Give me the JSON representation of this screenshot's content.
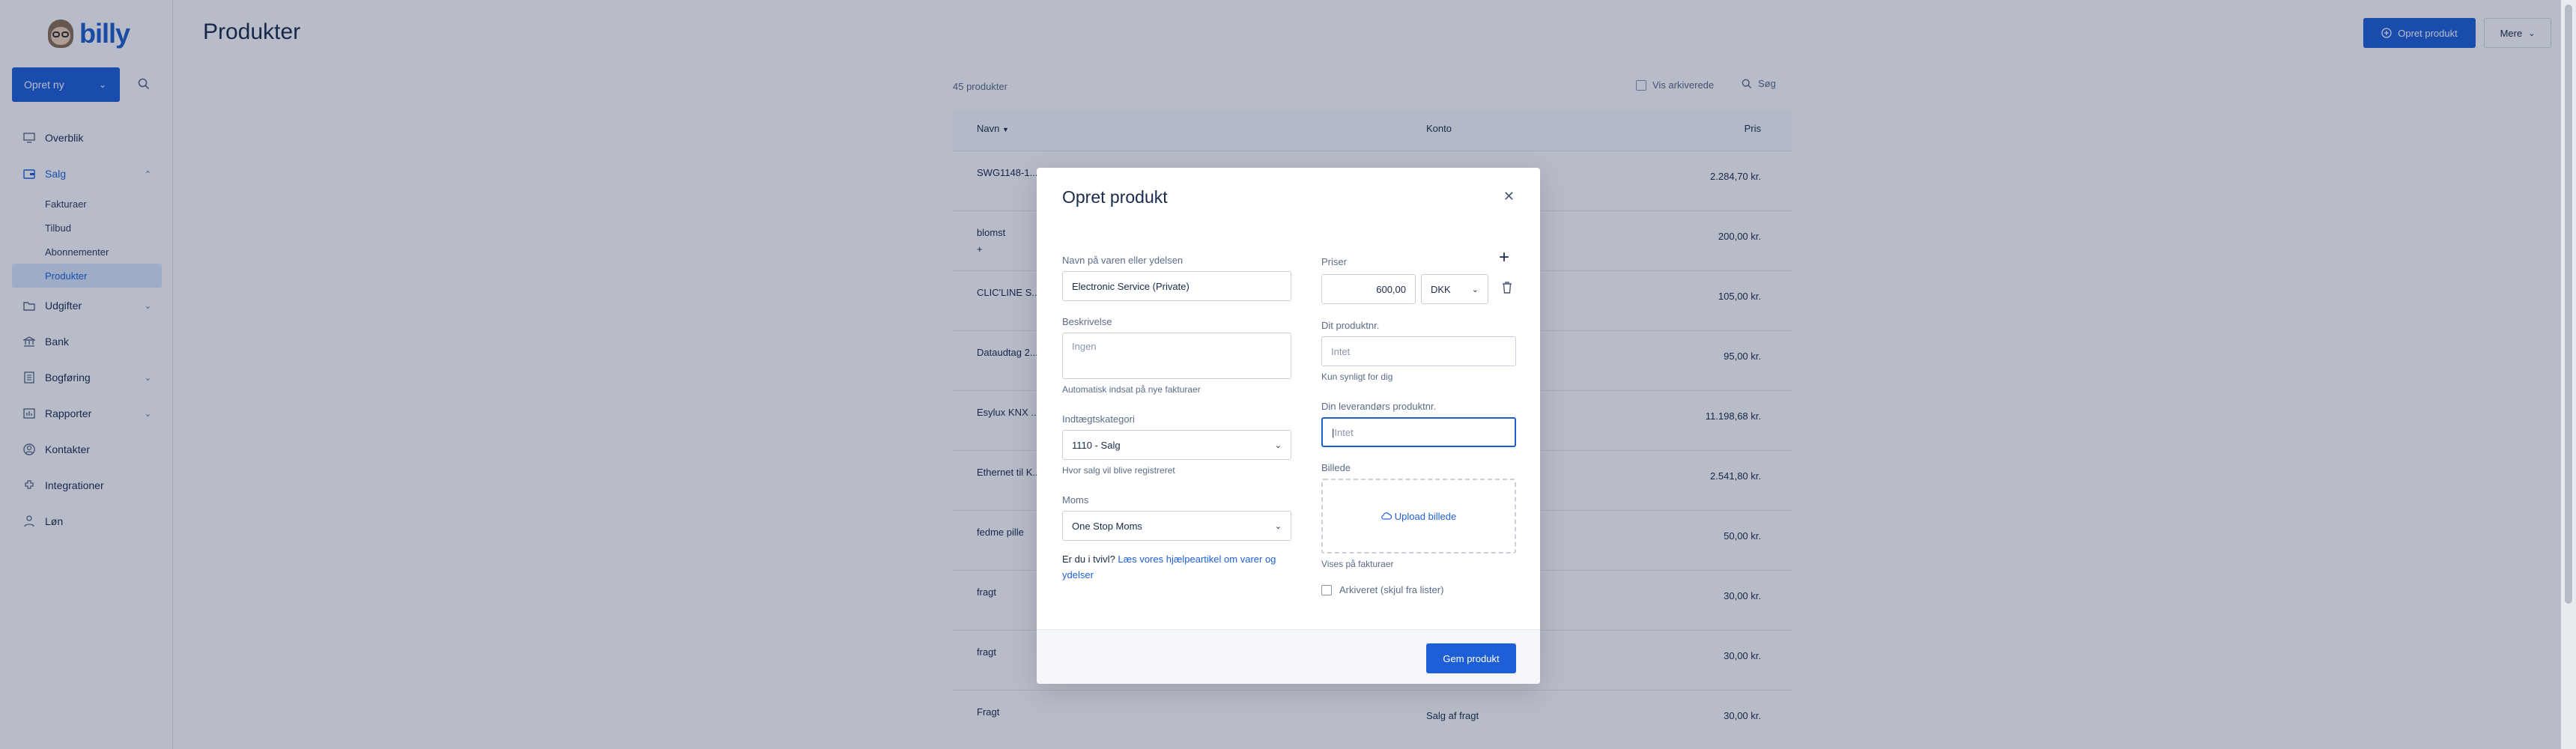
{
  "app": {
    "logo_text": "billy"
  },
  "sidebar": {
    "new_button": "Opret ny",
    "items": [
      {
        "label": "Overblik",
        "icon": "monitor-icon"
      },
      {
        "label": "Salg",
        "icon": "wallet-icon"
      },
      {
        "label": "Udgifter",
        "icon": "folder-icon"
      },
      {
        "label": "Bank",
        "icon": "bank-icon"
      },
      {
        "label": "Bogføring",
        "icon": "ledger-icon"
      },
      {
        "label": "Rapporter",
        "icon": "report-icon"
      },
      {
        "label": "Kontakter",
        "icon": "contact-icon"
      },
      {
        "label": "Integrationer",
        "icon": "integration-icon"
      },
      {
        "label": "Løn",
        "icon": "salary-icon"
      }
    ],
    "salg_sub": [
      "Fakturaer",
      "Tilbud",
      "Abonnementer",
      "Produkter"
    ]
  },
  "header": {
    "title": "Produkter",
    "create_button": "Opret produkt",
    "more_button": "Mere"
  },
  "list": {
    "count": "45 produkter",
    "show_archived": "Vis arkiverede",
    "search": "Søg",
    "columns": {
      "name": "Navn",
      "account": "Konto",
      "price": "Pris"
    },
    "rows": [
      {
        "name": "SWG1148-1...",
        "account": "",
        "price": "2.284,70 kr."
      },
      {
        "name": "blomst\n+",
        "account": "",
        "price": "200,00 kr."
      },
      {
        "name": "CLIC'LINE S...",
        "account": "",
        "price": "105,00 kr."
      },
      {
        "name": "Dataudtag 2...",
        "account": "",
        "price": "95,00 kr."
      },
      {
        "name": "Esylux KNX ...",
        "account": "",
        "price": "11.198,68 kr."
      },
      {
        "name": "Ethernet til K...",
        "account": "",
        "price": "2.541,80 kr."
      },
      {
        "name": "fedme pille",
        "account": "",
        "price": "50,00 kr."
      },
      {
        "name": "fragt",
        "account": "",
        "price": "30,00 kr."
      },
      {
        "name": "fragt",
        "account": "",
        "price": "30,00 kr."
      },
      {
        "name": "Fragt",
        "account": "Salg af fragt",
        "price": "30,00 kr."
      }
    ]
  },
  "modal": {
    "title": "Opret produkt",
    "name_label": "Navn på varen eller ydelsen",
    "name_value": "Electronic Service (Private)",
    "description_label": "Beskrivelse",
    "description_placeholder": "Ingen",
    "description_hint": "Automatisk indsat på nye fakturaer",
    "revenue_label": "Indtægtskategori",
    "revenue_value": "1110 - Salg",
    "revenue_hint": "Hvor salg vil blive registreret",
    "vat_label": "Moms",
    "vat_value": "One Stop Moms",
    "help_prefix": "Er du i tvivl? ",
    "help_link": "Læs vores hjælpeartikel om varer og ydelser",
    "prices_label": "Priser",
    "price_value": "600,00",
    "currency_value": "DKK",
    "own_productno_label": "Dit produktnr.",
    "own_productno_placeholder": "Intet",
    "own_productno_hint": "Kun synligt for dig",
    "supplier_productno_label": "Din leverandørs produktnr.",
    "supplier_productno_placeholder": "Intet",
    "image_label": "Billede",
    "upload_label": "Upload billede",
    "image_hint": "Vises på fakturaer",
    "archived_label": "Arkiveret (skjul fra lister)",
    "save_button": "Gem produkt"
  },
  "colors": {
    "primary": "#1e5fd8",
    "text": "#1a2a4a",
    "muted": "#5b6b87"
  }
}
